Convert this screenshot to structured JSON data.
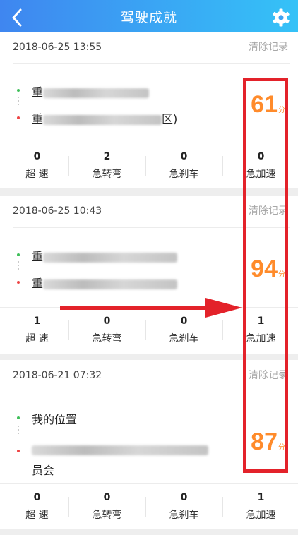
{
  "header": {
    "title": "驾驶成就",
    "back_icon": "chevron-left-icon",
    "settings_icon": "gear-icon"
  },
  "records": [
    {
      "date": "2018-06-25  13:55",
      "clear_label": "清除记录",
      "start_prefix": "重",
      "start_suffix": "",
      "end_prefix": "重",
      "end_suffix": "区)",
      "end_tail": "",
      "score": "61",
      "score_unit": "分",
      "stats": [
        {
          "value": "0",
          "label": "超 速"
        },
        {
          "value": "2",
          "label": "急转弯"
        },
        {
          "value": "0",
          "label": "急刹车"
        },
        {
          "value": "0",
          "label": "急加速"
        }
      ]
    },
    {
      "date": "2018-06-25  10:43",
      "clear_label": "清除记录",
      "start_prefix": "重",
      "start_suffix": "",
      "end_prefix": "重",
      "end_suffix": "",
      "end_tail": "",
      "score": "94",
      "score_unit": "分",
      "stats": [
        {
          "value": "1",
          "label": "超 速"
        },
        {
          "value": "0",
          "label": "急转弯"
        },
        {
          "value": "0",
          "label": "急刹车"
        },
        {
          "value": "1",
          "label": "急加速"
        }
      ]
    },
    {
      "date": "2018-06-21  07:32",
      "clear_label": "清除记录",
      "start_prefix": "我的位置",
      "start_suffix": "",
      "end_prefix": "",
      "end_suffix": "",
      "end_tail": "员会",
      "score": "87",
      "score_unit": "分",
      "stats": [
        {
          "value": "0",
          "label": "超 速"
        },
        {
          "value": "0",
          "label": "急转弯"
        },
        {
          "value": "0",
          "label": "急刹车"
        },
        {
          "value": "1",
          "label": "急加速"
        }
      ]
    }
  ],
  "annotation": {
    "box_color": "#e3222a",
    "arrow_color": "#e3222a"
  },
  "colors": {
    "header_start": "#3f86f0",
    "header_end": "#35c2f7",
    "score": "#ff8b2b"
  }
}
